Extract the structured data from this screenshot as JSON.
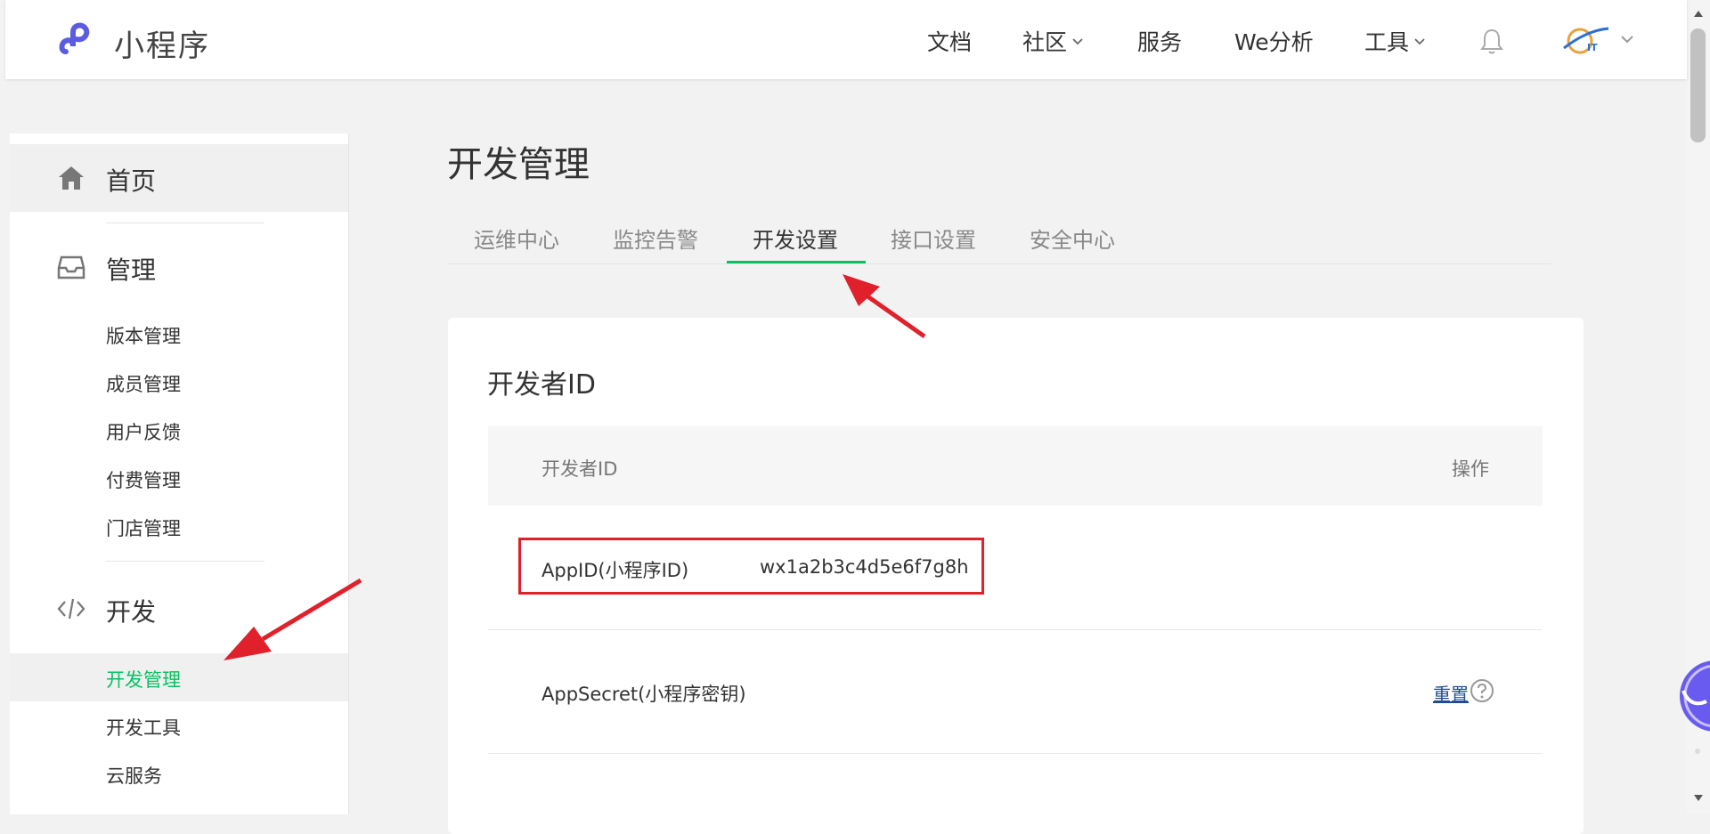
{
  "header": {
    "brand": "小程序",
    "nav": [
      {
        "label": "文档",
        "dropdown": false
      },
      {
        "label": "社区",
        "dropdown": true
      },
      {
        "label": "服务",
        "dropdown": false
      },
      {
        "label": "We分析",
        "dropdown": false
      },
      {
        "label": "工具",
        "dropdown": true
      }
    ]
  },
  "sidebar": {
    "home": "首页",
    "manage": {
      "label": "管理",
      "items": [
        "版本管理",
        "成员管理",
        "用户反馈",
        "付费管理",
        "门店管理"
      ]
    },
    "dev": {
      "label": "开发",
      "items": [
        "开发管理",
        "开发工具",
        "云服务"
      ],
      "active": "开发管理"
    }
  },
  "main": {
    "title": "开发管理",
    "tabs": [
      "运维中心",
      "监控告警",
      "开发设置",
      "接口设置",
      "安全中心"
    ],
    "active_tab": "开发设置",
    "card": {
      "title": "开发者ID",
      "headers": {
        "name": "开发者ID",
        "action": "操作"
      },
      "rows": [
        {
          "label": "AppID(小程序ID)",
          "value": "wx1a2b3c4d5e6f7g8h"
        },
        {
          "label": "AppSecret(小程序密钥)",
          "action": "重置"
        }
      ]
    }
  },
  "colors": {
    "accent_green": "#07c160",
    "annotation_red": "#e0212c",
    "brand_purple": "#5b5ce0",
    "link": "#1f4e8f"
  }
}
